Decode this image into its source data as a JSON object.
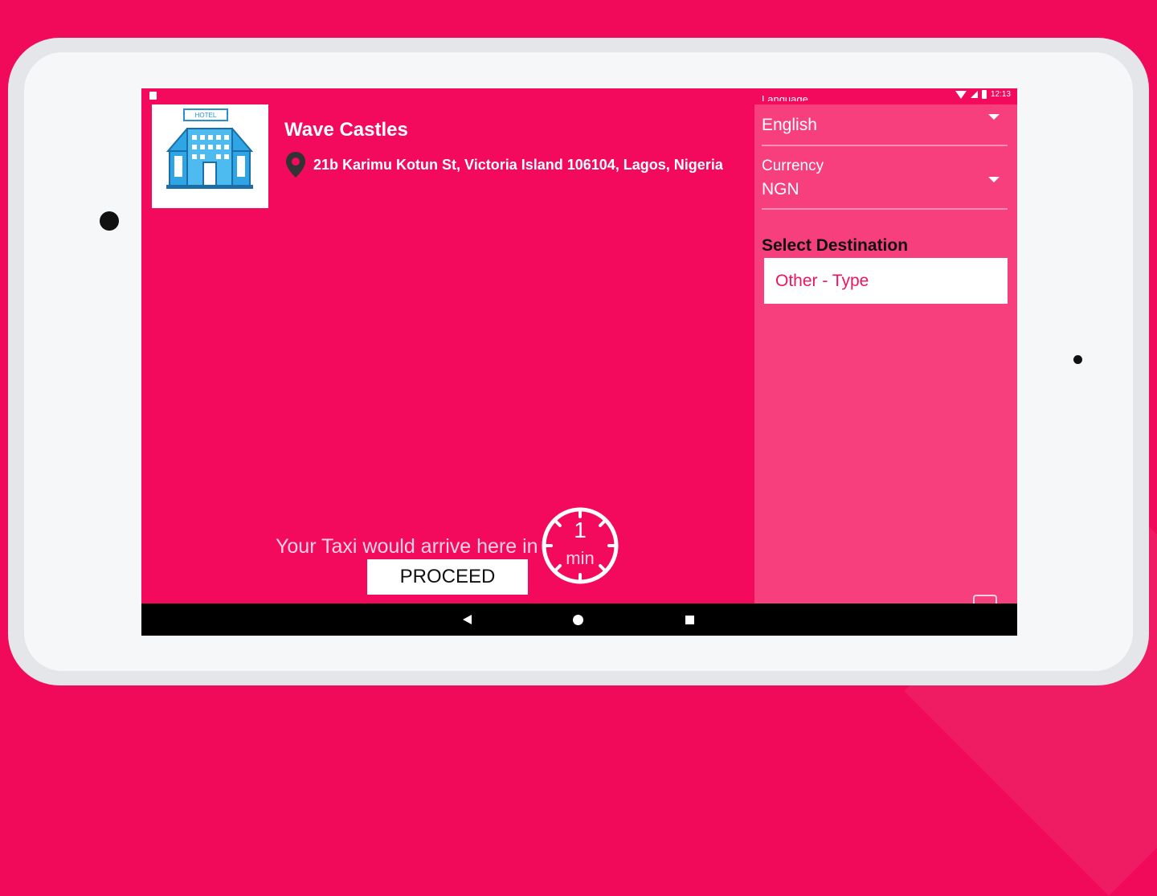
{
  "status_bar": {
    "time": "12:13"
  },
  "hotel": {
    "name": "Wave Castles",
    "address": "21b Karimu Kotun St, Victoria Island 106104, Lagos, Nigeria",
    "logo_icon": "hotel-building-icon",
    "logo_sign": "HOTEL"
  },
  "sidebar": {
    "language": {
      "label": "Language",
      "value": "English"
    },
    "currency": {
      "label": "Currency",
      "value": "NGN"
    },
    "destination": {
      "label": "Select Destination",
      "placeholder": "Other - Type"
    }
  },
  "taxi": {
    "message": "Your Taxi would arrive here in",
    "eta_value": "1",
    "eta_unit": "min",
    "proceed_label": "PROCEED"
  },
  "colors": {
    "brand_pink": "#f30a5c",
    "sidebar_pink": "#f73f7e",
    "nav_black": "#000000"
  }
}
